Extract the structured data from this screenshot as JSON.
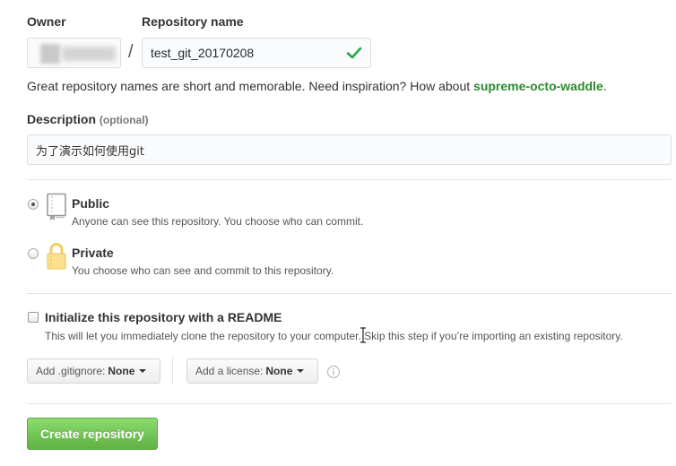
{
  "owner": {
    "label": "Owner"
  },
  "repo": {
    "label": "Repository name",
    "value": "test_git_20170208",
    "separator": "/"
  },
  "hint": {
    "text": "Great repository names are short and memorable. Need inspiration? How about ",
    "suggestion": "supreme-octo-waddle",
    "suffix": "."
  },
  "description": {
    "label": "Description",
    "optional": "(optional)",
    "value": "为了演示如何使用git"
  },
  "visibility": {
    "public": {
      "title": "Public",
      "desc": "Anyone can see this repository. You choose who can commit.",
      "icon": "book-icon",
      "selected": true
    },
    "private": {
      "title": "Private",
      "desc": "You choose who can see and commit to this repository.",
      "icon": "lock-icon",
      "selected": false
    }
  },
  "readme": {
    "title": "Initialize this repository with a README",
    "desc": "This will let you immediately clone the repository to your computer. Skip this step if you’re importing an existing repository.",
    "checked": false
  },
  "gitignore": {
    "prefix": "Add .gitignore:",
    "value": "None"
  },
  "license": {
    "prefix": "Add a license:",
    "value": "None"
  },
  "create_button": {
    "label": "Create repository"
  },
  "colors": {
    "accent_green": "#2c8a2c",
    "button_green": "#60b044",
    "check_green": "#28a745"
  }
}
